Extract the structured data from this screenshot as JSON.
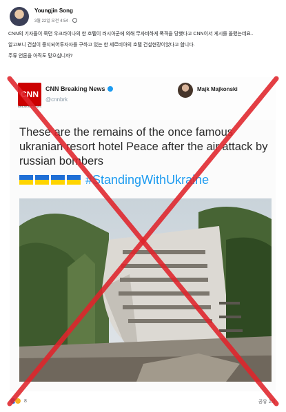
{
  "post": {
    "author": "Youngjin Song",
    "timestamp": "3월 22일 오전 4:54 ·",
    "lines": [
      "CNN의 기자들이 묵던 우크라이나의 한 호텔이 러시아군에 의해 무자비하게 폭격을 당했다고 CNN이서 게시를 올렸는데요..",
      "알고보니 건설이 중지되어투자자를 구하고 있는 한 세르비아의 호텔 건설현장이었다고 합니다.",
      "주류 언론을 아직도 믿으십니까?"
    ]
  },
  "embed": {
    "account_name": "CNN Breaking News",
    "handle": "@cnnbrk",
    "logo_text": "CNN",
    "logo_sub": "BREAKING NEWS",
    "second_account": "Majk Majkonski",
    "headline": "These are the remains of the once famous ukranian resort hotel Peace after the air attack by russian bombers",
    "hashtag": "#StandingWithUkraine",
    "flag_color_top": "#1f6fd6",
    "flag_color_bottom": "#ffd400"
  },
  "footer": {
    "reaction_count": "8",
    "shares": "공유 2회"
  },
  "overlay": {
    "color": "#e0242b",
    "icon": "red-x-mark"
  }
}
